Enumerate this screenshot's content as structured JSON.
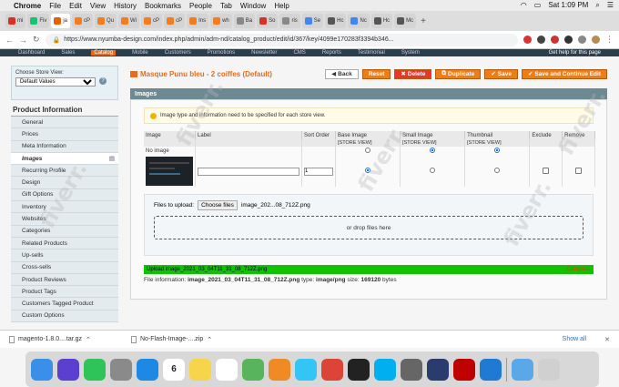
{
  "menubar": {
    "app": "Chrome",
    "items": [
      "File",
      "Edit",
      "View",
      "History",
      "Bookmarks",
      "People",
      "Tab",
      "Window",
      "Help"
    ],
    "clock": "Sat 1:09 PM"
  },
  "tabs": [
    {
      "label": "mi",
      "color": "#d93025"
    },
    {
      "label": "Fiv",
      "color": "#1dbf73"
    },
    {
      "label": "ja",
      "color": "#e66000",
      "active": true
    },
    {
      "label": "cP",
      "color": "#f47c20"
    },
    {
      "label": "Qu",
      "color": "#f47c20"
    },
    {
      "label": "Wi",
      "color": "#f47c20"
    },
    {
      "label": "cP",
      "color": "#f47c20"
    },
    {
      "label": "cP",
      "color": "#f47c20"
    },
    {
      "label": "Ins",
      "color": "#f47c20"
    },
    {
      "label": "wh",
      "color": "#f47c20"
    },
    {
      "label": "Ba",
      "color": "#888888"
    },
    {
      "label": "So",
      "color": "#d93025"
    },
    {
      "label": "ris",
      "color": "#888888"
    },
    {
      "label": "Se",
      "color": "#4285f4"
    },
    {
      "label": "Hc",
      "color": "#555555"
    },
    {
      "label": "Nc",
      "color": "#4285f4"
    },
    {
      "label": "Hc",
      "color": "#555555"
    },
    {
      "label": "Mc",
      "color": "#555555"
    }
  ],
  "address": {
    "url": "https://www.nyumba-design.com/index.php/admin/adm-nd/catalog_product/edit/id/367/key/4099e170283f3394b346..."
  },
  "magento_nav": {
    "items": [
      "Dashboard",
      "Sales",
      "Catalog",
      "Mobile",
      "Customers",
      "Promotions",
      "Newsletter",
      "CMS",
      "Reports",
      "Testimonial",
      "System"
    ],
    "active": "Catalog",
    "help": "Get help for this page"
  },
  "sidebar": {
    "store_label": "Choose Store View:",
    "store_value": "Default Values",
    "title": "Product Information",
    "items": [
      "General",
      "Prices",
      "Meta Information",
      "Images",
      "Recurring Profile",
      "Design",
      "Gift Options",
      "Inventory",
      "Websites",
      "Categories",
      "Related Products",
      "Up-sells",
      "Cross-sells",
      "Product Reviews",
      "Product Tags",
      "Customers Tagged Product",
      "Custom Options"
    ],
    "selected": "Images"
  },
  "product": {
    "title": "Masque Punu bleu - 2 coiffes (Default)"
  },
  "buttons": {
    "back": "Back",
    "reset": "Reset",
    "delete": "Delete",
    "duplicate": "Duplicate",
    "save": "Save",
    "save_continue": "Save and Continue Edit"
  },
  "images": {
    "section_title": "Images",
    "notice": "Image type and information need to be specified for each store view.",
    "columns": [
      "Image",
      "Label",
      "Sort Order",
      "Base Image",
      "Small Image",
      "Thumbnail",
      "Exclude",
      "Remove"
    ],
    "store_view_tag": "[STORE VIEW]",
    "no_image": "No image",
    "sort_order_value": "1",
    "files_label": "Files to upload:",
    "choose_files": "Choose files",
    "chosen_file": "image_202...08_712Z.png",
    "drop_text": "or drop files here",
    "progress_text": "Upload image_2021_03_04T11_31_08_712Z.png",
    "progress_status": "Complete",
    "progress_percent": 100,
    "file_info_prefix": "File information:",
    "file_name": "image_2021_03_04T11_31_08_712Z.png",
    "file_type_label": "type:",
    "file_type": "image/png",
    "file_size_label": "size:",
    "file_size": "169120",
    "file_size_unit": "bytes"
  },
  "downloads": {
    "items": [
      "magento-1.8.0....tar.gz",
      "No-Flash-Image-....zip"
    ],
    "show_all": "Show all",
    "close": "✕"
  },
  "dock": {
    "icons": [
      {
        "name": "finder",
        "color": "#3b8fe8"
      },
      {
        "name": "siri",
        "color": "#5a3fd0"
      },
      {
        "name": "facetime",
        "color": "#2ec45a"
      },
      {
        "name": "launchpad",
        "color": "#8a8a8a"
      },
      {
        "name": "safari",
        "color": "#1e88e5"
      },
      {
        "name": "calendar",
        "color": "#ffffff"
      },
      {
        "name": "notes",
        "color": "#f7d54a"
      },
      {
        "name": "reminders",
        "color": "#ffffff"
      },
      {
        "name": "maps",
        "color": "#58b55e"
      },
      {
        "name": "photos",
        "color": "#f08a24"
      },
      {
        "name": "messages",
        "color": "#33c5f3"
      },
      {
        "name": "chrome",
        "color": "#db4437"
      },
      {
        "name": "terminal",
        "color": "#222222"
      },
      {
        "name": "skype",
        "color": "#00aff0"
      },
      {
        "name": "settings",
        "color": "#666666"
      },
      {
        "name": "cloud-app",
        "color": "#2a3b6e"
      },
      {
        "name": "filezilla",
        "color": "#bf0000"
      },
      {
        "name": "vscode",
        "color": "#1f7ad4"
      },
      {
        "name": "downloads-folder",
        "color": "#5aa8e8"
      },
      {
        "name": "trash",
        "color": "#d0d0d0"
      }
    ],
    "calendar_day": "6"
  },
  "watermark": "fiverr."
}
